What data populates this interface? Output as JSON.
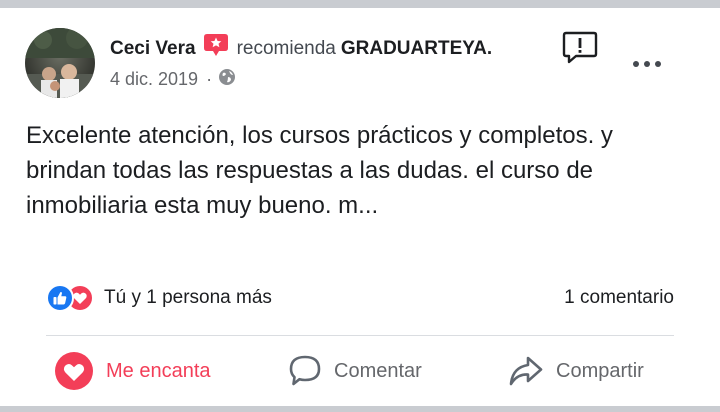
{
  "post": {
    "author": "Ceci Vera",
    "recommend_text": "recomienda",
    "page_name": "GRADUARTEYA.",
    "date": "4 dic. 2019",
    "separator": "·",
    "privacy_icon": "globe-icon",
    "body": "Excelente atención, los cursos prácticos y completos. y brindan todas las respuestas a las dudas. el curso de inmobiliaria esta muy bueno. m..."
  },
  "reactions": {
    "icons": [
      "like-icon",
      "love-icon"
    ],
    "summary": "Tú y 1 persona más",
    "comments": "1 comentario"
  },
  "actions": {
    "love_label": "Me encanta",
    "comment_label": "Comentar",
    "share_label": "Compartir"
  },
  "colors": {
    "love": "#f33e58",
    "like": "#1877f2",
    "secondary_text": "#65676b",
    "divider": "#dadde1",
    "frame": "#c9ccd1"
  }
}
